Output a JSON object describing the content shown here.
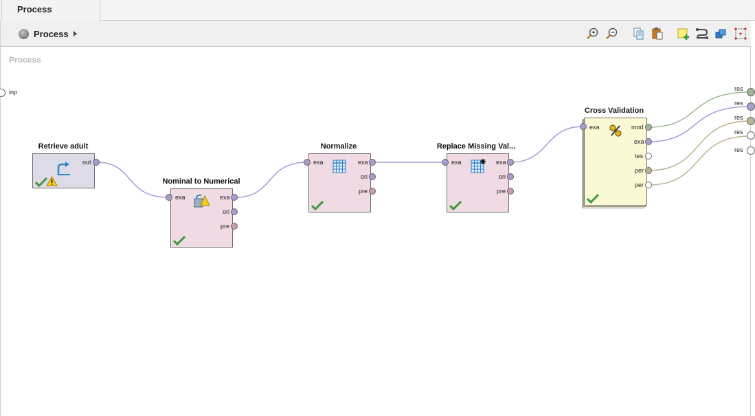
{
  "tab": {
    "label": "Process"
  },
  "breadcrumb": {
    "label": "Process"
  },
  "toolbar": {
    "buttons": [
      "zoom-in-icon",
      "zoom-out-icon",
      "copy-icon",
      "paste-icon",
      "add-note-icon",
      "auto-wire-icon",
      "arrange-icon",
      "fit-view-icon"
    ]
  },
  "canvas": {
    "title": "Process",
    "input_port": "inp",
    "result_ports": [
      "res",
      "res",
      "res",
      "res",
      "res"
    ]
  },
  "operators": {
    "retrieve": {
      "title": "Retrieve adult",
      "out": "out",
      "status": "warning"
    },
    "nominal": {
      "title": "Nominal to Numerical",
      "in": "exa",
      "outs": [
        "exa",
        "ori",
        "pre"
      ]
    },
    "normalize": {
      "title": "Normalize",
      "in": "exa",
      "outs": [
        "exa",
        "ori",
        "pre"
      ]
    },
    "replace": {
      "title": "Replace Missing Val...",
      "in": "exa",
      "outs": [
        "exa",
        "ori",
        "pre"
      ]
    },
    "cv": {
      "title": "Cross Validation",
      "in": "exa",
      "outs": [
        "mod",
        "exa",
        "tes",
        "per",
        "per"
      ]
    }
  },
  "colors": {
    "example_set": "#a89bd0",
    "model": "#9fb597",
    "performance": "#bdb38f",
    "preprocessing": "#c99ab0"
  }
}
